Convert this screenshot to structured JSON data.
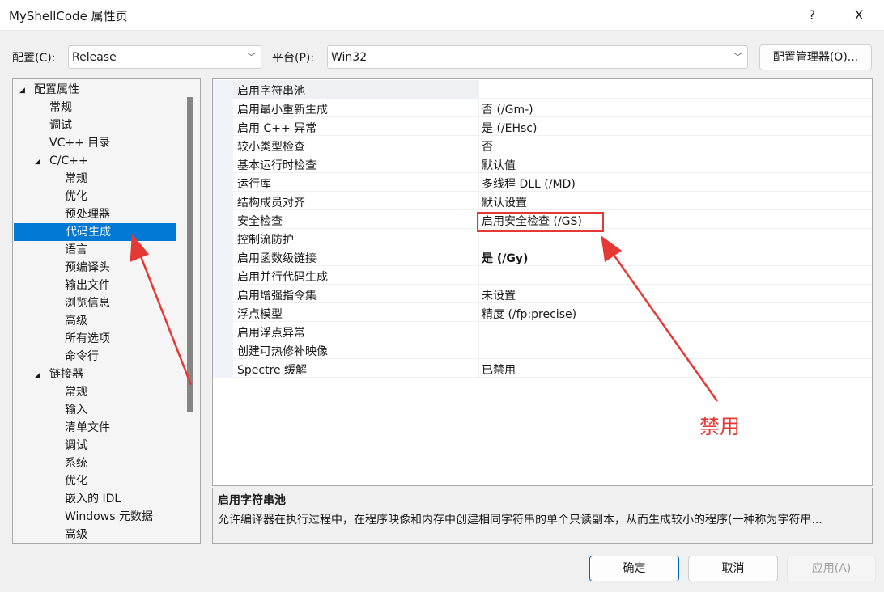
{
  "window": {
    "title": "MyShellCode 属性页",
    "help": "?",
    "close": "X"
  },
  "toolbar": {
    "config_label": "配置(C):",
    "config_value": "Release",
    "platform_label": "平台(P):",
    "platform_value": "Win32",
    "manager_button": "配置管理器(O)..."
  },
  "tree": [
    {
      "label": "配置属性",
      "level": 0,
      "expanded": true
    },
    {
      "label": "常规",
      "level": 1
    },
    {
      "label": "调试",
      "level": 1
    },
    {
      "label": "VC++ 目录",
      "level": 1
    },
    {
      "label": "C/C++",
      "level": 1,
      "expanded": true
    },
    {
      "label": "常规",
      "level": 2
    },
    {
      "label": "优化",
      "level": 2
    },
    {
      "label": "预处理器",
      "level": 2
    },
    {
      "label": "代码生成",
      "level": 2,
      "selected": true
    },
    {
      "label": "语言",
      "level": 2
    },
    {
      "label": "预编译头",
      "level": 2
    },
    {
      "label": "输出文件",
      "level": 2
    },
    {
      "label": "浏览信息",
      "level": 2
    },
    {
      "label": "高级",
      "level": 2
    },
    {
      "label": "所有选项",
      "level": 2
    },
    {
      "label": "命令行",
      "level": 2
    },
    {
      "label": "链接器",
      "level": 1,
      "expanded": true
    },
    {
      "label": "常规",
      "level": 2
    },
    {
      "label": "输入",
      "level": 2
    },
    {
      "label": "清单文件",
      "level": 2
    },
    {
      "label": "调试",
      "level": 2
    },
    {
      "label": "系统",
      "level": 2
    },
    {
      "label": "优化",
      "level": 2
    },
    {
      "label": "嵌入的 IDL",
      "level": 2
    },
    {
      "label": "Windows 元数据",
      "level": 2
    },
    {
      "label": "高级",
      "level": 2
    }
  ],
  "properties": [
    {
      "name": "启用字符串池",
      "value": "",
      "selected": true
    },
    {
      "name": "启用最小重新生成",
      "value": "否 (/Gm-)"
    },
    {
      "name": "启用 C++ 异常",
      "value": "是 (/EHsc)"
    },
    {
      "name": "较小类型检查",
      "value": "否"
    },
    {
      "name": "基本运行时检查",
      "value": "默认值"
    },
    {
      "name": "运行库",
      "value": "多线程 DLL (/MD)"
    },
    {
      "name": "结构成员对齐",
      "value": "默认设置"
    },
    {
      "name": "安全检查",
      "value": "启用安全检查 (/GS)",
      "highlighted": true
    },
    {
      "name": "控制流防护",
      "value": ""
    },
    {
      "name": "启用函数级链接",
      "value": "是 (/Gy)",
      "bold": true
    },
    {
      "name": "启用并行代码生成",
      "value": ""
    },
    {
      "name": "启用增强指令集",
      "value": "未设置"
    },
    {
      "name": "浮点模型",
      "value": "精度 (/fp:precise)"
    },
    {
      "name": "启用浮点异常",
      "value": ""
    },
    {
      "name": "创建可热修补映像",
      "value": ""
    },
    {
      "name": "Spectre 缓解",
      "value": "已禁用"
    }
  ],
  "description": {
    "title": "启用字符串池",
    "text": "允许编译器在执行过程中，在程序映像和内存中创建相同字符串的单个只读副本，从而生成较小的程序(一种称为字符串..."
  },
  "annotation": {
    "text": "禁用",
    "color": "#e53935"
  },
  "buttons": {
    "ok": "确定",
    "cancel": "取消",
    "apply": "应用(A)"
  },
  "colors": {
    "selection": "#0078d4",
    "annotation": "#e53935"
  }
}
